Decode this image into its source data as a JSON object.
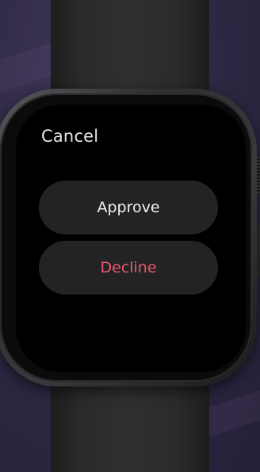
{
  "screen": {
    "cancel_label": "Cancel",
    "actions": [
      {
        "label": "Approve",
        "color": "#f2f2f2"
      },
      {
        "label": "Decline",
        "color": "#e85a6c"
      }
    ]
  }
}
